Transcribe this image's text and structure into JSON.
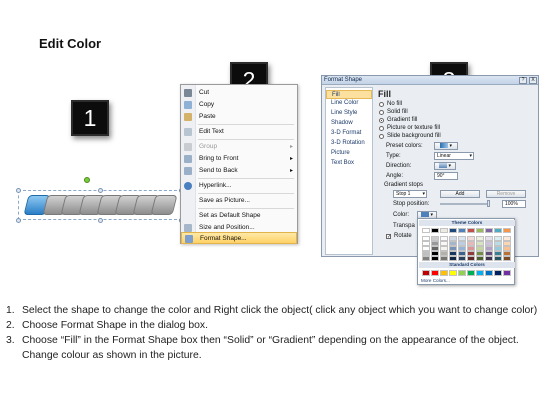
{
  "title": "Edit Color",
  "badges": [
    "1",
    "2",
    "3"
  ],
  "context_menu": {
    "items": [
      {
        "label": "Cut",
        "underline": "t",
        "icon": "scissors-icon",
        "enabled": true,
        "submenu": false
      },
      {
        "label": "Copy",
        "icon": "copy-icon",
        "enabled": true,
        "submenu": false
      },
      {
        "label": "Paste",
        "icon": "paste-icon",
        "enabled": true,
        "submenu": false
      },
      {
        "label": "Edit Text",
        "icon": "edit-text-icon",
        "enabled": true,
        "submenu": false
      },
      {
        "label": "Group",
        "icon": "group-icon",
        "enabled": false,
        "submenu": true
      },
      {
        "label": "Bring to Front",
        "icon": "bring-front-icon",
        "enabled": true,
        "submenu": true
      },
      {
        "label": "Send to Back",
        "icon": "send-back-icon",
        "enabled": true,
        "submenu": true
      },
      {
        "label": "Hyperlink...",
        "icon": "hyperlink-icon",
        "enabled": true,
        "submenu": false
      },
      {
        "label": "Save as Picture...",
        "icon": "",
        "enabled": true,
        "submenu": false
      },
      {
        "label": "Set as Default Shape",
        "icon": "",
        "enabled": true,
        "submenu": false
      },
      {
        "label": "Size and Position...",
        "icon": "size-icon",
        "enabled": true,
        "submenu": false
      },
      {
        "label": "Format Shape...",
        "icon": "format-shape-icon",
        "enabled": true,
        "submenu": false,
        "highlighted": true
      }
    ]
  },
  "format_dialog": {
    "title": "Format Shape",
    "help": "?",
    "close": "X",
    "categories": [
      "Fill",
      "Line Color",
      "Line Style",
      "Shadow",
      "3-D Format",
      "3-D Rotation",
      "Picture",
      "Text Box"
    ],
    "selected_category": "Fill",
    "heading": "Fill",
    "options": [
      "No fill",
      "Solid fill",
      "Gradient fill",
      "Picture or texture fill",
      "Slide background fill"
    ],
    "selected_option": "Gradient fill",
    "preset_label": "Preset colors:",
    "type_label": "Type:",
    "type_value": "Linear",
    "direction_label": "Direction:",
    "angle_label": "Angle:",
    "angle_value": "90°",
    "stops_label": "Gradient stops",
    "stop_value": "Stop 1",
    "add_label": "Add",
    "remove_label": "Remove",
    "stop_position_label": "Stop position:",
    "stop_position_value": "100%",
    "color_label": "Color:",
    "transparency_label": "Transpa",
    "rotate_label": "Rotate"
  },
  "color_popup": {
    "theme_label": "Theme Colors",
    "standard_label": "Standard Colors",
    "more_label": "More Colors...",
    "theme_top": [
      "#ffffff",
      "#000000",
      "#eeece1",
      "#1f497d",
      "#4f81bd",
      "#c0504d",
      "#9bbb59",
      "#8064a2",
      "#4bacc6",
      "#f79646"
    ],
    "standard": [
      "#c00000",
      "#ff0000",
      "#ffc000",
      "#ffff00",
      "#92d050",
      "#00b050",
      "#00b0f0",
      "#0070c0",
      "#002060",
      "#7030a0"
    ]
  },
  "steps": [
    {
      "num": "1.",
      "text": "Select the shape to change the color and Right click the object( click any object which you want to change color)"
    },
    {
      "num": "2.",
      "text": "Choose Format Shape in the dialog box."
    },
    {
      "num": "3.",
      "text": "Choose “Fill” in the Format Shape box then “Solid” or “Gradient” depending on the appearance of the object. Change colour as shown in the picture."
    }
  ]
}
